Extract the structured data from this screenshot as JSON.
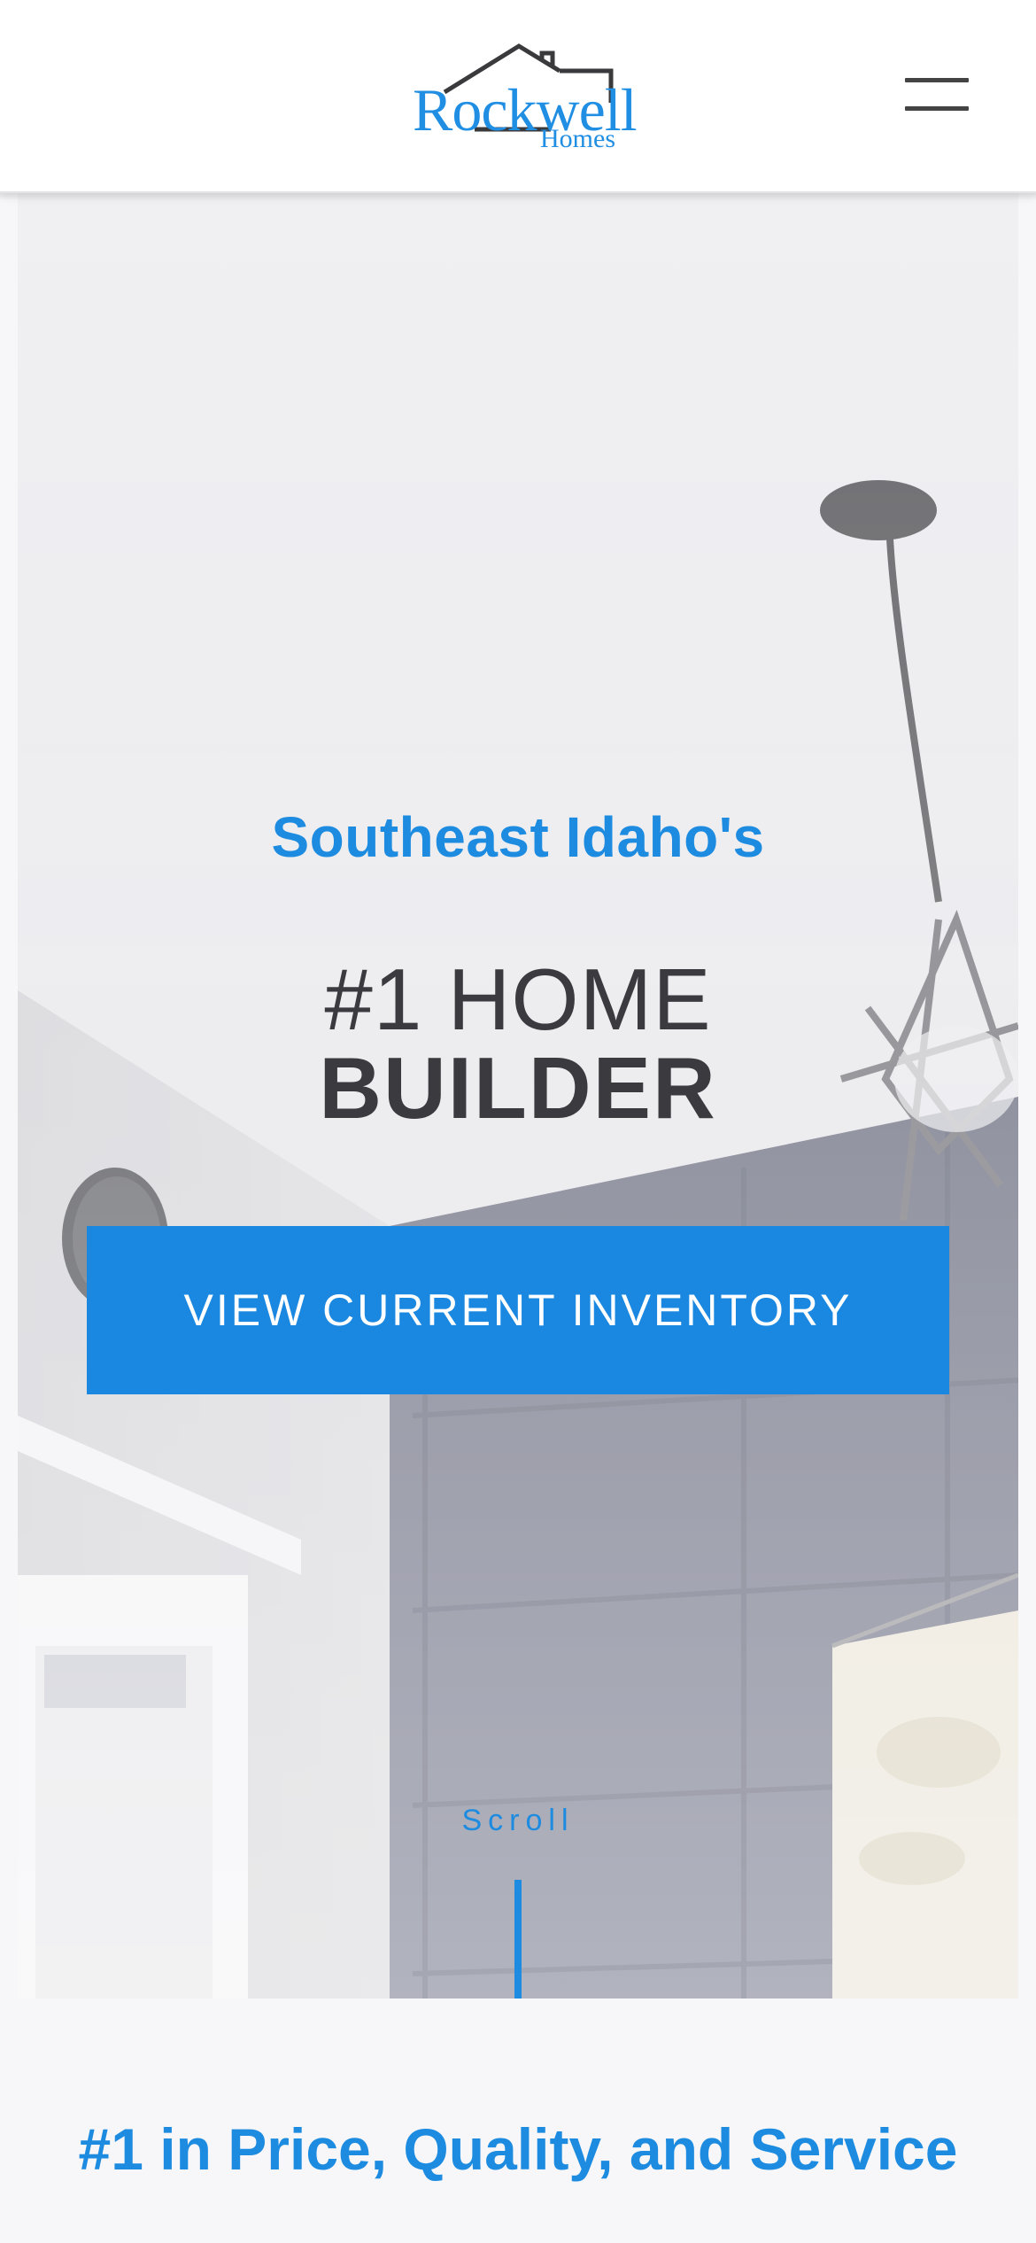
{
  "header": {
    "logo": {
      "wordmark": "Rockwell",
      "sub": "Homes",
      "icon": "house-roof-icon"
    },
    "menu_icon": "hamburger-menu-icon"
  },
  "hero": {
    "pretitle": "Southeast Idaho's",
    "title_line1": "#1 HOME",
    "title_line2": "BUILDER",
    "cta_label": "VIEW CURRENT INVENTORY",
    "scroll_label": "Scroll"
  },
  "section": {
    "title": "#1 in Price, Quality, and Service"
  },
  "colors": {
    "brand_blue": "#1a88e1",
    "text_dark": "#3b3b3f",
    "header_bg": "#ffffff"
  }
}
